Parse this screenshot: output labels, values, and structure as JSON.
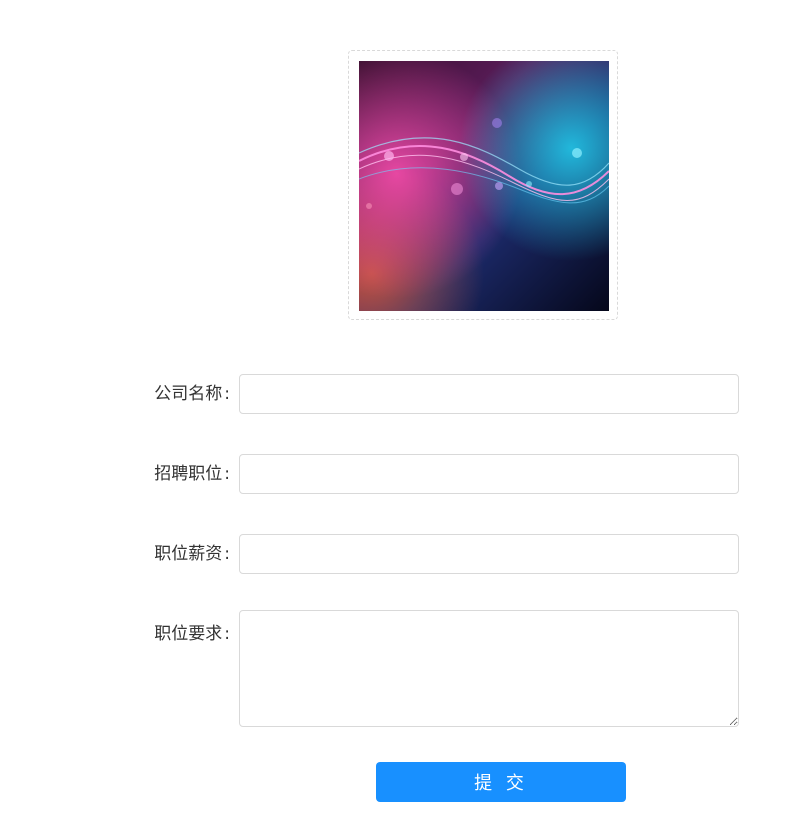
{
  "upload": {
    "image_description_icon": "abstract-wave-image"
  },
  "form": {
    "company_name": {
      "label": "公司名称",
      "value": ""
    },
    "position": {
      "label": "招聘职位",
      "value": ""
    },
    "salary": {
      "label": "职位薪资",
      "value": ""
    },
    "requirements": {
      "label": "职位要求",
      "value": ""
    },
    "colon": ":"
  },
  "submit": {
    "label": "提 交"
  },
  "colors": {
    "primary": "#1890ff",
    "border": "#d9d9d9",
    "text": "#333333"
  }
}
